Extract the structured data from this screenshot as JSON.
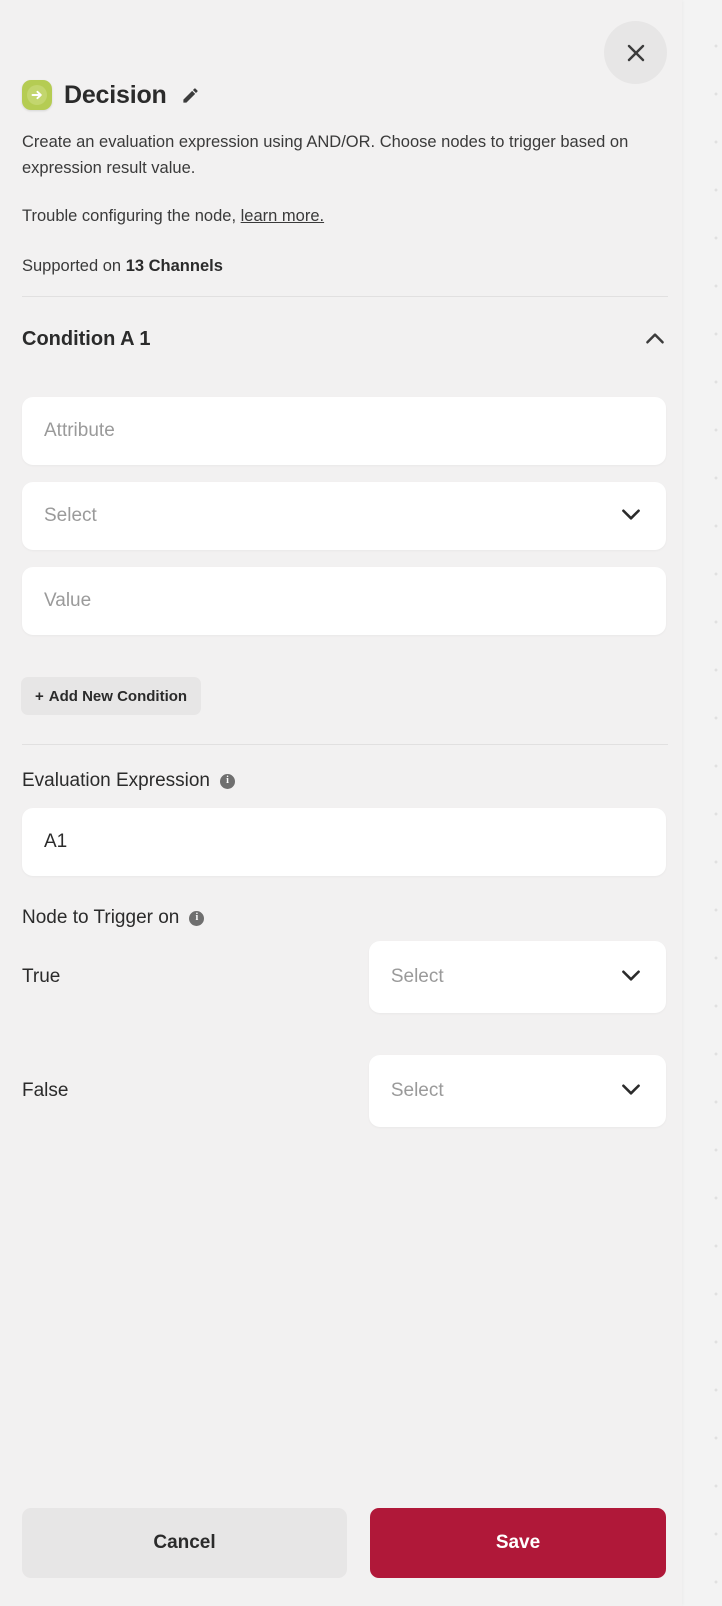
{
  "panel": {
    "close_icon": "close-icon",
    "node_icon": "decision-node-icon",
    "title": "Decision",
    "edit_icon": "pencil-edit-icon",
    "description": "Create an evaluation expression using AND/OR. Choose nodes to trigger based on expression result value.",
    "trouble_prefix": "Trouble configuring the node,",
    "learn_more_label": "learn more.",
    "supported_prefix": "Supported on",
    "supported_value": "13 Channels"
  },
  "condition": {
    "title": "Condition A 1",
    "collapse_icon": "chevron-up-icon",
    "attribute": {
      "value": "",
      "placeholder": "Attribute"
    },
    "operator": {
      "value": "",
      "placeholder": "Select",
      "chevron_icon": "chevron-down-icon"
    },
    "value": {
      "value": "",
      "placeholder": "Value"
    },
    "add_condition_label": "Add New Condition",
    "add_condition_plus": "+"
  },
  "evaluation": {
    "label": "Evaluation Expression",
    "info_icon": "info-icon",
    "info_glyph": "i",
    "expression_value": "A1",
    "expression_placeholder": ""
  },
  "node_trigger": {
    "label": "Node to Trigger on",
    "info_icon": "info-icon",
    "info_glyph": "i",
    "rows": [
      {
        "label": "True",
        "select_value": "",
        "select_placeholder": "Select",
        "chevron_icon": "chevron-down-icon"
      },
      {
        "label": "False",
        "select_value": "",
        "select_placeholder": "Select",
        "chevron_icon": "chevron-down-icon"
      }
    ]
  },
  "footer": {
    "cancel_label": "Cancel",
    "save_label": "Save"
  },
  "colors": {
    "panel_bg": "#f2f1f1",
    "canvas_bg": "#f3f3f3",
    "field_bg": "#ffffff",
    "accent_save": "#b01839",
    "node_icon_green": "#b5cc53",
    "muted_text": "#9a9a9a",
    "primary_text": "#2b2b2b",
    "button_gray": "#e7e6e6"
  }
}
